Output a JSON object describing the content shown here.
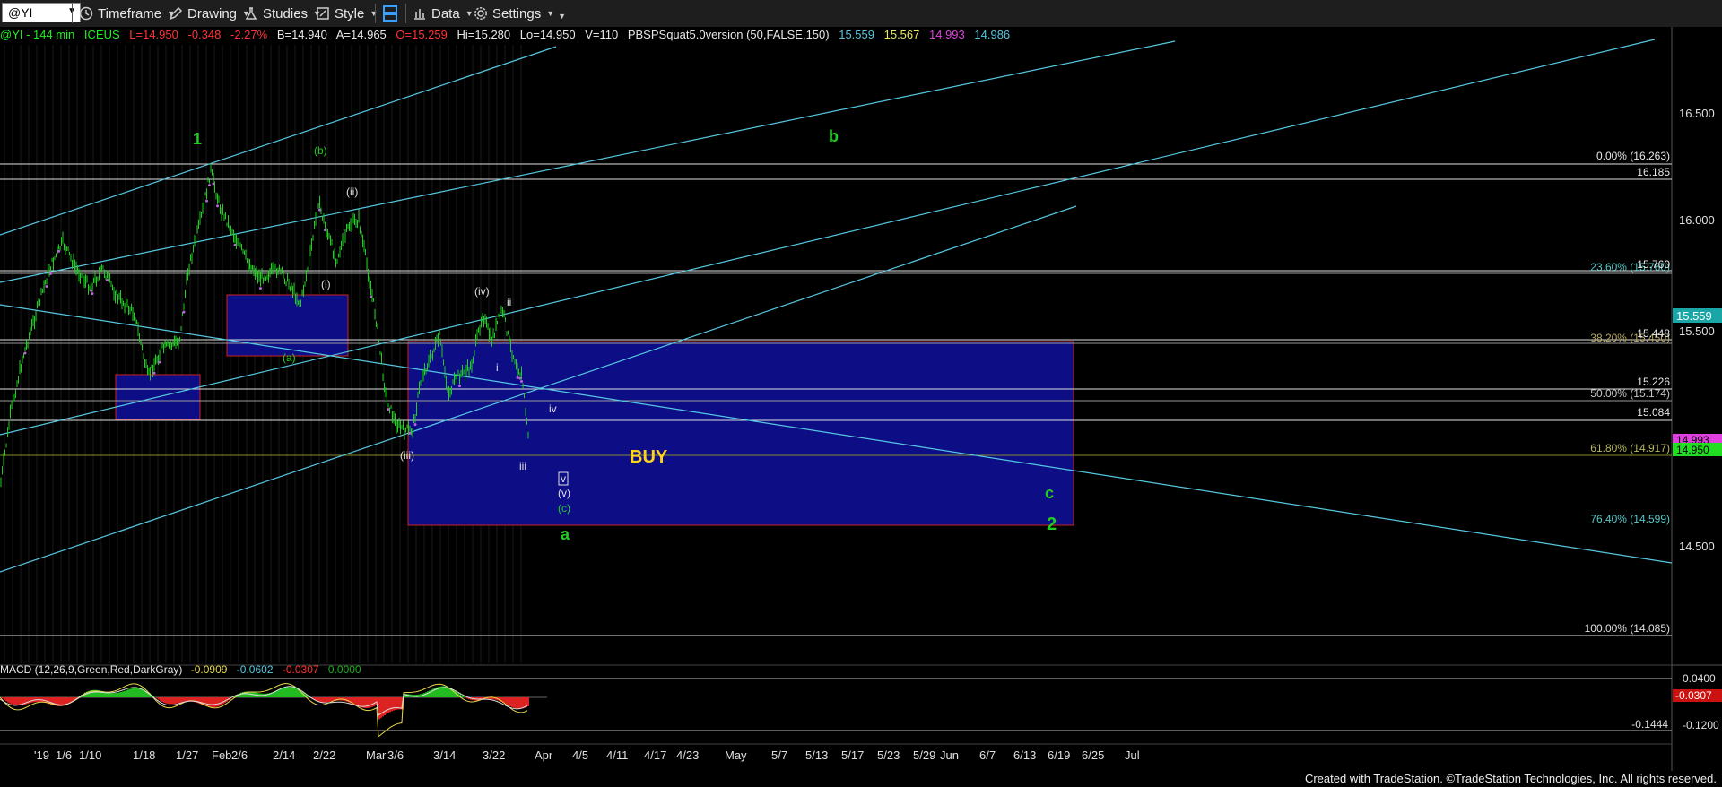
{
  "toolbar": {
    "symbol": "@YI",
    "timeframe": "Timeframe",
    "drawing": "Drawing",
    "studies": "Studies",
    "style": "Style",
    "data": "Data",
    "settings": "Settings"
  },
  "infobar": {
    "symbol": "@YI - 144 min",
    "exchange": "ICEUS",
    "last": "L=14.950",
    "change": "-0.348",
    "pct": "-2.27%",
    "bid": "B=14.940",
    "ask": "A=14.965",
    "open": "O=15.259",
    "hi": "Hi=15.280",
    "lo": "Lo=14.950",
    "vol": "V=110",
    "study": "PBSPSquat5.0version (50,FALSE,150)",
    "v1": "15.559",
    "v2": "15.567",
    "v3": "14.993",
    "v4": "14.986"
  },
  "colors": {
    "up": "#22cc22",
    "down": "#dd2222",
    "fib": "#e0e0e0",
    "channel": "#55c8e0",
    "box": "#0d0d86",
    "buy": "#ffd21e"
  },
  "price_axis": {
    "ticks": [
      "16.500",
      "16.000",
      "15.500",
      "14.500"
    ],
    "last_price": "15.559",
    "tag_pink": "14.993",
    "tag_green": "14.950"
  },
  "fib_levels": [
    {
      "label": "0.00% (16.263)"
    },
    {
      "label": "23.60% (15.760)"
    },
    {
      "label": "38.20% (15.450)"
    },
    {
      "label": "50.00% (15.174)"
    },
    {
      "label": "61.80% (14.917)"
    },
    {
      "label": "76.40% (14.599)"
    },
    {
      "label": "100.00% (14.085)"
    }
  ],
  "level_labels": [
    "16.185",
    "15.760",
    "15.448",
    "15.226",
    "15.084"
  ],
  "wave_labels": {
    "w1": "1",
    "wb_small": "(b)",
    "wii_paren": "(ii)",
    "wi_paren": "(i)",
    "wa_paren": "(a)",
    "wiii_paren": "(iii)",
    "wiv_paren": "(iv)",
    "wii": "ii",
    "wi": "i",
    "wiv": "iv",
    "wiii": "iii",
    "wv": "v",
    "wv_paren": "(v)",
    "wc_paren": "(c)",
    "wa": "a",
    "wb": "b",
    "wc": "c",
    "w2": "2",
    "buy": "BUY"
  },
  "macd": {
    "title": "MACD (12,26,9,Green,Red,DarkGray)",
    "v1": "-0.0909",
    "v2": "-0.0602",
    "v3": "-0.0307",
    "v4": "0.0000",
    "axis_top": "0.0400",
    "axis_tag": "-0.0307",
    "axis_bottom": "-0.1200",
    "axis_min_label": "-0.1444"
  },
  "date_axis": [
    "'19",
    "1/6",
    "1/10",
    "1/18",
    "1/27",
    "Feb",
    "2/6",
    "2/14",
    "2/22",
    "Mar",
    "3/6",
    "3/14",
    "3/22",
    "Apr",
    "4/5",
    "4/11",
    "4/17",
    "4/23",
    "May",
    "5/7",
    "5/13",
    "5/17",
    "5/23",
    "5/29",
    "Jun",
    "6/7",
    "6/13",
    "6/19",
    "6/25",
    "Jul"
  ],
  "footer": "Created with TradeStation. ©TradeStation Technologies, Inc. All rights reserved."
}
